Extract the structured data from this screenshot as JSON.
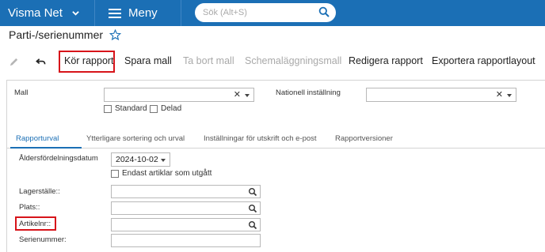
{
  "app": {
    "brand": "Visma Net",
    "menu_label": "Meny",
    "search_placeholder": "Sök (Alt+S)",
    "accent_color": "#1b6fb5"
  },
  "page": {
    "title": "Parti-/serienummer"
  },
  "toolbar": {
    "edit_icon": "pencil-icon",
    "undo_icon": "undo-icon",
    "run_report": "Kör rapport",
    "save_template": "Spara mall",
    "delete_template": "Ta bort mall",
    "schedule_template": "Schemaläggningsmall",
    "edit_report": "Redigera rapport",
    "export_layout": "Exportera rapportlayout"
  },
  "form": {
    "template_label": "Mall",
    "template_value": "",
    "standard_label": "Standard",
    "shared_label": "Delad",
    "national_label": "Nationell inställning",
    "national_value": ""
  },
  "tabs": [
    {
      "label": "Rapporturval",
      "active": true
    },
    {
      "label": "Ytterligare sortering och urval",
      "active": false
    },
    {
      "label": "Inställningar för utskrift och e-post",
      "active": false
    },
    {
      "label": "Rapportversioner",
      "active": false
    }
  ],
  "params": {
    "aging_date_label": "Åldersfördelningsdatum",
    "aging_date_value": "2024-10-02",
    "discontinued_label": "Endast artiklar som utgått",
    "warehouse_label": "Lagerställe::",
    "location_label": "Plats::",
    "item_label": "Artikelnr::",
    "serial_label": "Serienummer:"
  },
  "highlight_color": "#d7141a"
}
